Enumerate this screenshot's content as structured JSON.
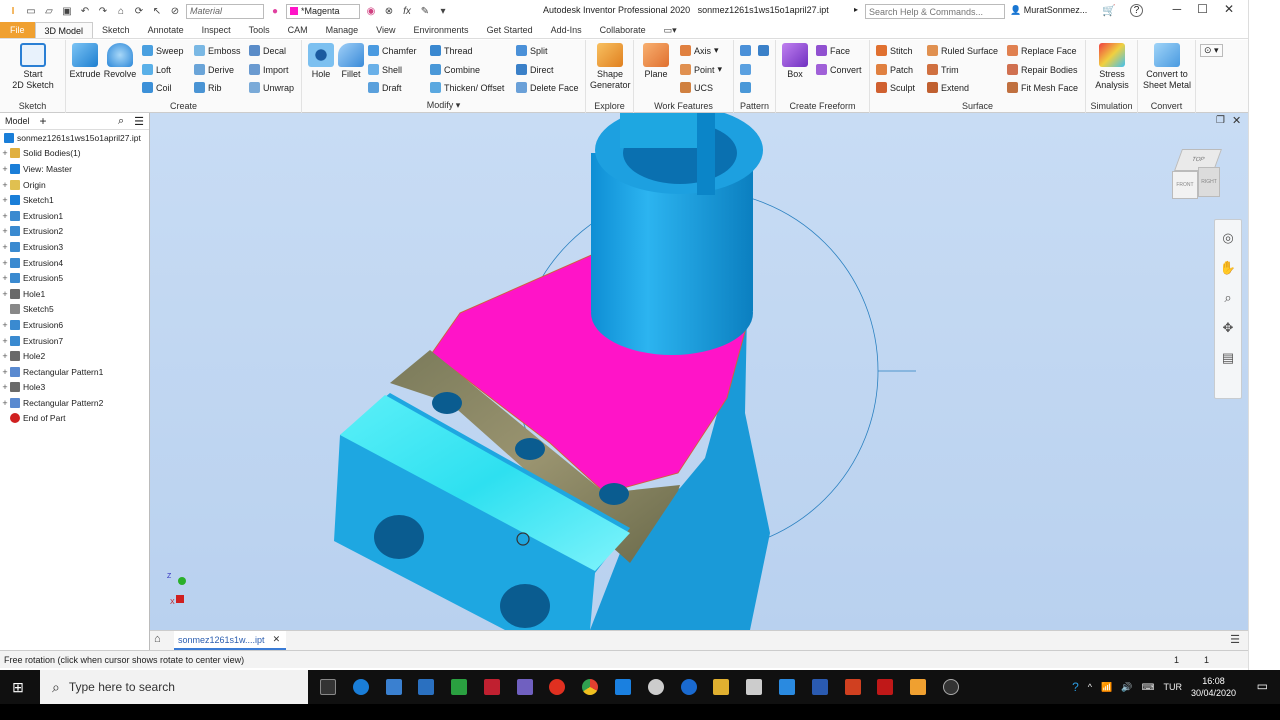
{
  "titlebar": {
    "material_placeholder": "Material",
    "appearance": "*Magenta",
    "app_title": "Autodesk Inventor Professional 2020",
    "file_name": "sonmez1261s1ws15o1april27.ipt",
    "search_placeholder": "Search Help & Commands...",
    "user": "MuratSonmez...",
    "help_icon": "?"
  },
  "tabs": [
    "File",
    "3D Model",
    "Sketch",
    "Annotate",
    "Inspect",
    "Tools",
    "CAM",
    "Manage",
    "View",
    "Environments",
    "Get Started",
    "Add-Ins",
    "Collaborate"
  ],
  "ribbon": {
    "sketch": {
      "label": "Sketch",
      "start": "Start",
      "start2": "2D Sketch"
    },
    "create": {
      "label": "Create",
      "extrude": "Extrude",
      "revolve": "Revolve",
      "sweep": "Sweep",
      "loft": "Loft",
      "coil": "Coil",
      "emboss": "Emboss",
      "derive": "Derive",
      "rib": "Rib",
      "decal": "Decal",
      "import": "Import",
      "unwrap": "Unwrap"
    },
    "modify": {
      "label": "Modify",
      "hole": "Hole",
      "fillet": "Fillet",
      "chamfer": "Chamfer",
      "shell": "Shell",
      "draft": "Draft",
      "thread": "Thread",
      "combine": "Combine",
      "thicken": "Thicken/ Offset",
      "split": "Split",
      "direct": "Direct",
      "delete_face": "Delete Face"
    },
    "explore": {
      "label": "Explore",
      "shape": "Shape",
      "generator": "Generator"
    },
    "work": {
      "label": "Work Features",
      "plane": "Plane",
      "axis": "Axis",
      "point": "Point",
      "ucs": "UCS"
    },
    "pattern": {
      "label": "Pattern"
    },
    "freeform": {
      "label": "Create Freeform",
      "box": "Box",
      "face": "Face",
      "convert": "Convert"
    },
    "surface": {
      "label": "Surface",
      "stitch": "Stitch",
      "patch": "Patch",
      "sculpt": "Sculpt",
      "ruled": "Ruled Surface",
      "trim": "Trim",
      "extend": "Extend",
      "replace": "Replace Face",
      "repair": "Repair Bodies",
      "fitmesh": "Fit Mesh Face"
    },
    "simulation": {
      "label": "Simulation",
      "stress": "Stress",
      "analysis": "Analysis"
    },
    "convert": {
      "label": "Convert",
      "convert_to": "Convert to",
      "sheet": "Sheet Metal"
    }
  },
  "browser": {
    "title": "Model",
    "plus": "+",
    "items": [
      {
        "label": "sonmez1261s1ws15o1april27.ipt",
        "exp": ""
      },
      {
        "label": "Solid Bodies(1)",
        "exp": "+"
      },
      {
        "label": "View: Master",
        "exp": "+"
      },
      {
        "label": "Origin",
        "exp": "+"
      },
      {
        "label": "Sketch1",
        "exp": "+"
      },
      {
        "label": "Extrusion1",
        "exp": "+"
      },
      {
        "label": "Extrusion2",
        "exp": "+"
      },
      {
        "label": "Extrusion3",
        "exp": "+"
      },
      {
        "label": "Extrusion4",
        "exp": "+"
      },
      {
        "label": "Extrusion5",
        "exp": "+"
      },
      {
        "label": "Hole1",
        "exp": "+"
      },
      {
        "label": "Sketch5",
        "exp": ""
      },
      {
        "label": "Extrusion6",
        "exp": "+"
      },
      {
        "label": "Extrusion7",
        "exp": "+"
      },
      {
        "label": "Hole2",
        "exp": "+"
      },
      {
        "label": "Rectangular Pattern1",
        "exp": "+"
      },
      {
        "label": "Hole3",
        "exp": "+"
      },
      {
        "label": "Rectangular Pattern2",
        "exp": "+"
      },
      {
        "label": "End of Part",
        "exp": ""
      }
    ]
  },
  "viewcube": {
    "top": "TOP",
    "front": "FRONT",
    "right": "RIGHT"
  },
  "triad": {
    "z": "Z",
    "x": "X"
  },
  "doctab": {
    "label": "sonmez1261s1w....ipt",
    "close": "✕"
  },
  "status": {
    "text": "Free rotation (click when cursor shows rotate to center view)",
    "n1": "1",
    "n2": "1"
  },
  "taskbar": {
    "search": "Type here to search",
    "lang": "TUR",
    "time": "16:08",
    "date": "30/04/2020"
  },
  "colors": {
    "accent": "#f0a030",
    "part": "#1ea7e1",
    "face": "#ff14c8",
    "viewport": "#c3d8f2"
  }
}
